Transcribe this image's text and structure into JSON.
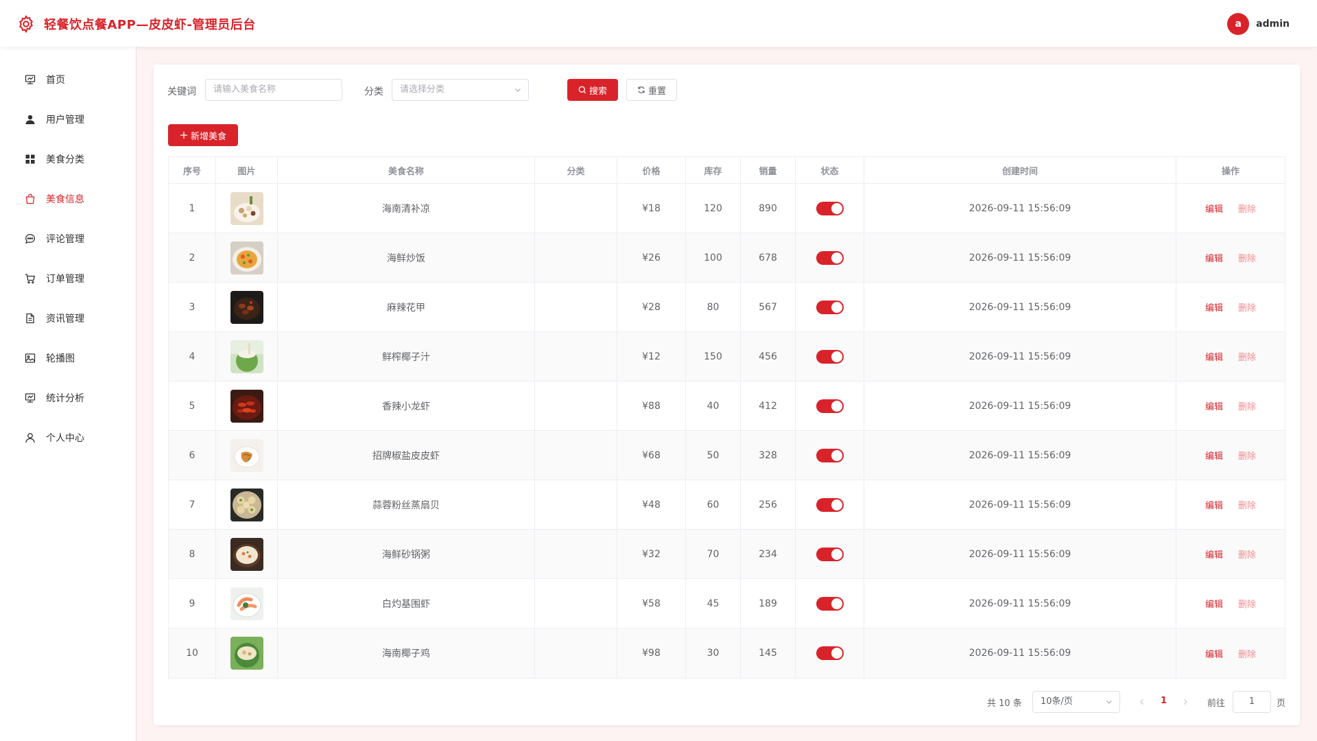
{
  "header": {
    "app_title": "轻餐饮点餐APP—皮皮虾-管理员后台",
    "avatar_letter": "a",
    "username": "admin"
  },
  "sidebar": {
    "items": [
      {
        "label": "首页",
        "icon": "dashboard-icon"
      },
      {
        "label": "用户管理",
        "icon": "user-icon"
      },
      {
        "label": "美食分类",
        "icon": "grid-icon"
      },
      {
        "label": "美食信息",
        "icon": "shopping-bag-icon",
        "active": true
      },
      {
        "label": "评论管理",
        "icon": "chat-icon"
      },
      {
        "label": "订单管理",
        "icon": "cart-icon"
      },
      {
        "label": "资讯管理",
        "icon": "document-icon"
      },
      {
        "label": "轮播图",
        "icon": "picture-icon"
      },
      {
        "label": "统计分析",
        "icon": "chart-icon"
      },
      {
        "label": "个人中心",
        "icon": "person-icon"
      }
    ]
  },
  "search": {
    "keyword_label": "关键词",
    "keyword_placeholder": "请输入美食名称",
    "category_label": "分类",
    "category_placeholder": "请选择分类",
    "search_button": "搜索",
    "reset_button": "重置"
  },
  "add_button": "新增美食",
  "table": {
    "columns": [
      "序号",
      "图片",
      "美食名称",
      "分类",
      "价格",
      "库存",
      "销量",
      "状态",
      "创建时间",
      "操作"
    ],
    "edit_label": "编辑",
    "delete_label": "删除",
    "rows": [
      {
        "index": "1",
        "name": "海南清补凉",
        "category": "",
        "price": "¥18",
        "stock": "120",
        "sales": "890",
        "status": true,
        "created": "2026-09-11 15:56:09"
      },
      {
        "index": "2",
        "name": "海鲜炒饭",
        "category": "",
        "price": "¥26",
        "stock": "100",
        "sales": "678",
        "status": true,
        "created": "2026-09-11 15:56:09"
      },
      {
        "index": "3",
        "name": "麻辣花甲",
        "category": "",
        "price": "¥28",
        "stock": "80",
        "sales": "567",
        "status": true,
        "created": "2026-09-11 15:56:09"
      },
      {
        "index": "4",
        "name": "鲜榨椰子汁",
        "category": "",
        "price": "¥12",
        "stock": "150",
        "sales": "456",
        "status": true,
        "created": "2026-09-11 15:56:09"
      },
      {
        "index": "5",
        "name": "香辣小龙虾",
        "category": "",
        "price": "¥88",
        "stock": "40",
        "sales": "412",
        "status": true,
        "created": "2026-09-11 15:56:09"
      },
      {
        "index": "6",
        "name": "招牌椒盐皮皮虾",
        "category": "",
        "price": "¥68",
        "stock": "50",
        "sales": "328",
        "status": true,
        "created": "2026-09-11 15:56:09"
      },
      {
        "index": "7",
        "name": "蒜蓉粉丝蒸扇贝",
        "category": "",
        "price": "¥48",
        "stock": "60",
        "sales": "256",
        "status": true,
        "created": "2026-09-11 15:56:09"
      },
      {
        "index": "8",
        "name": "海鲜砂锅粥",
        "category": "",
        "price": "¥32",
        "stock": "70",
        "sales": "234",
        "status": true,
        "created": "2026-09-11 15:56:09"
      },
      {
        "index": "9",
        "name": "白灼基围虾",
        "category": "",
        "price": "¥58",
        "stock": "45",
        "sales": "189",
        "status": true,
        "created": "2026-09-11 15:56:09"
      },
      {
        "index": "10",
        "name": "海南椰子鸡",
        "category": "",
        "price": "¥98",
        "stock": "30",
        "sales": "145",
        "status": true,
        "created": "2026-09-11 15:56:09"
      }
    ]
  },
  "pagination": {
    "total_text": "共 10 条",
    "page_size": "10条/页",
    "current_page": "1",
    "goto_label": "前往",
    "goto_value": "1",
    "page_suffix": "页"
  },
  "colors": {
    "accent": "#d9232a",
    "accent_light": "#f08b8f",
    "background": "#fdf3f3"
  }
}
